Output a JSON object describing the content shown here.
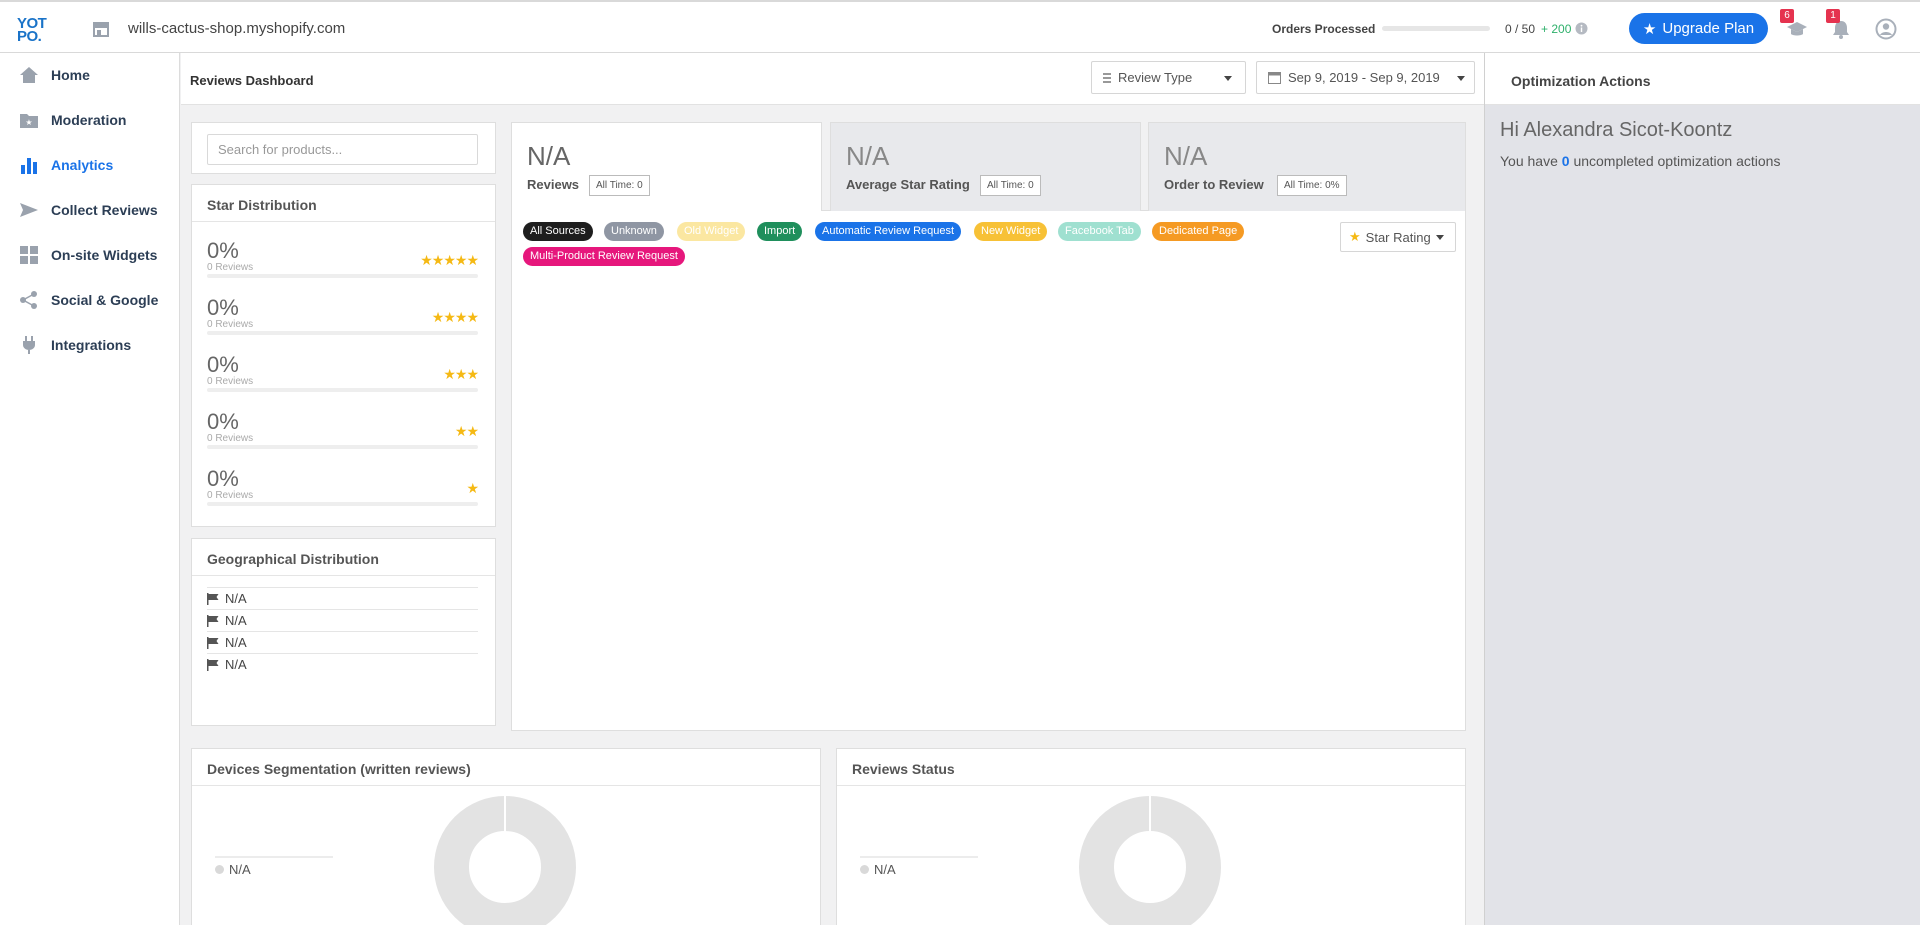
{
  "app": {
    "logo_line1": "YOT",
    "logo_line2": "PO.",
    "store_url": "wills-cactus-shop.myshopify.com"
  },
  "topbar": {
    "orders_label": "Orders Processed",
    "orders_progress": 0,
    "orders_count": "0 / 50",
    "orders_plus": "+ 200",
    "upgrade_label": "Upgrade Plan",
    "learning_badge": "6",
    "notifications_badge": "1"
  },
  "sidebar": {
    "items": [
      {
        "label": "Home",
        "icon": "home-icon"
      },
      {
        "label": "Moderation",
        "icon": "folder-star-icon"
      },
      {
        "label": "Analytics",
        "icon": "bar-chart-icon",
        "active": true
      },
      {
        "label": "Collect Reviews",
        "icon": "paper-plane-icon"
      },
      {
        "label": "On-site Widgets",
        "icon": "widgets-grid-icon"
      },
      {
        "label": "Social & Google",
        "icon": "share-icon"
      },
      {
        "label": "Integrations",
        "icon": "plug-icon"
      }
    ]
  },
  "main": {
    "title": "Reviews Dashboard",
    "review_type_label": "Review Type",
    "date_range": "Sep 9, 2019 - Sep 9, 2019",
    "search_placeholder": "Search for products...",
    "star_distribution": {
      "title": "Star Distribution",
      "rows": [
        {
          "pct": "0%",
          "count": "0 Reviews",
          "stars": "★★★★★"
        },
        {
          "pct": "0%",
          "count": "0 Reviews",
          "stars": "★★★★"
        },
        {
          "pct": "0%",
          "count": "0 Reviews",
          "stars": "★★★"
        },
        {
          "pct": "0%",
          "count": "0 Reviews",
          "stars": "★★"
        },
        {
          "pct": "0%",
          "count": "0 Reviews",
          "stars": "★"
        }
      ]
    },
    "geo": {
      "title": "Geographical Distribution",
      "rows": [
        "N/A",
        "N/A",
        "N/A",
        "N/A"
      ]
    },
    "metrics": [
      {
        "value": "N/A",
        "label": "Reviews",
        "chip": "All Time: 0"
      },
      {
        "value": "N/A",
        "label": "Average Star Rating",
        "chip": "All Time: 0"
      },
      {
        "value": "N/A",
        "label": "Order to Review",
        "chip": "All Time: 0%"
      }
    ],
    "sources": [
      {
        "label": "All Sources",
        "color": "#1e1e1e"
      },
      {
        "label": "Unknown",
        "color": "#8f96a3"
      },
      {
        "label": "Old Widget",
        "color": "#fbe7a1"
      },
      {
        "label": "Import",
        "color": "#1f8f5c"
      },
      {
        "label": "Automatic Review Request",
        "color": "#1a73e8"
      },
      {
        "label": "New Widget",
        "color": "#f7c136"
      },
      {
        "label": "Facebook Tab",
        "color": "#9fe0d0"
      },
      {
        "label": "Dedicated Page",
        "color": "#f59a23"
      },
      {
        "label": "Multi-Product Review Request",
        "color": "#e6177c"
      }
    ],
    "star_rating_label": "Star Rating",
    "devices": {
      "title": "Devices Segmentation (written reviews)",
      "legend": "N/A"
    },
    "status": {
      "title": "Reviews Status",
      "legend": "N/A"
    }
  },
  "optimization": {
    "title": "Optimization Actions",
    "greeting": "Hi Alexandra Sicot-Koontz",
    "msg_prefix": "You have",
    "count": "0",
    "msg_suffix": "uncompleted optimization actions"
  }
}
